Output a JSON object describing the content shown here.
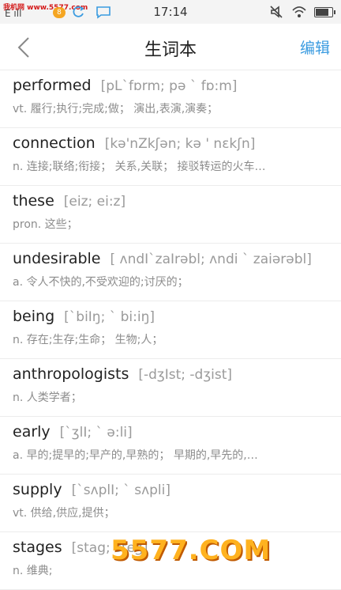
{
  "statusbar": {
    "watermark": "我机网 www.5577.com",
    "carrier": "E ıll",
    "notification_count": "8",
    "time": "17:14",
    "battery_level": 0.85
  },
  "nav": {
    "back_icon": "chevron-left-icon",
    "title": "生词本",
    "edit_label": "编辑"
  },
  "words": [
    {
      "word": "performed",
      "phonetic": "[pL`fɒrm; pə ` fɒ:m]",
      "definition": "vt. 履行;执行;完成;做； 演出,表演,演奏；"
    },
    {
      "word": "connection",
      "phonetic": "[kə'nZkʃən; kə ' nɛkʃn]",
      "definition": "n. 连接;联络;衔接； 关系,关联； 接驳转运的火车…"
    },
    {
      "word": "these",
      "phonetic": "[eiz; ei:z]",
      "definition": "pron. 这些；"
    },
    {
      "word": "undesirable",
      "phonetic": "[ ʌndI`zaIrəbl; ʌndi ` zaiərəbl]",
      "definition": "a. 令人不快的,不受欢迎的;讨厌的；"
    },
    {
      "word": "being",
      "phonetic": "[`biIŋ; ` bi:iŋ]",
      "definition": "n. 存在;生存;生命； 生物;人；"
    },
    {
      "word": "anthropologists",
      "phonetic": "[-dʒIst; -dʒist]",
      "definition": "n. 人类学者；"
    },
    {
      "word": "early",
      "phonetic": "[`ʒlI; ` ə:li]",
      "definition": "a. 早的;提早的;早产的,早熟的； 早期的,早先的,…"
    },
    {
      "word": "supply",
      "phonetic": "[`sʌplI; ` sʌpli]",
      "definition": "vt. 供给,供应,提供；"
    },
    {
      "word": "stages",
      "phonetic": "[stag; steʒ]",
      "definition": "n. 维典;"
    }
  ],
  "overlay": {
    "logo_text": "5577.COM"
  },
  "colors": {
    "accent": "#3a9be0",
    "phonetic": "#9a9a9a",
    "definition": "#8c8c8c"
  }
}
